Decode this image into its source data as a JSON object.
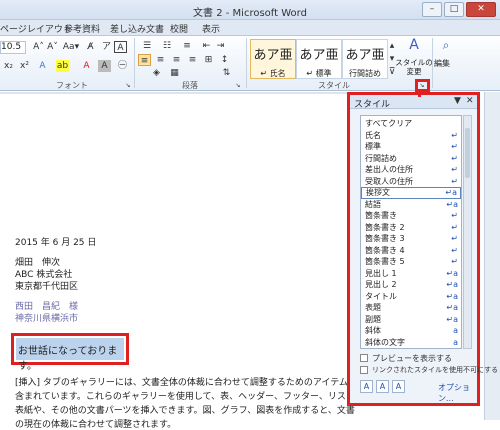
{
  "window": {
    "title": "文書 2 - Microsoft Word",
    "min": "–",
    "max": "□",
    "close": "✕"
  },
  "tabs": [
    "ページレイアウト",
    "参考資料",
    "差し込み文書",
    "校閲",
    "表示"
  ],
  "ribbon": {
    "font_size": "10.5",
    "font_labels": [
      "A˄",
      "A˅",
      "Aa▾",
      "A̸",
      "ア",
      "A"
    ],
    "font_group_label": "フォント",
    "para_group_label": "段落",
    "style_group_label": "スタイル",
    "style_boxes": [
      {
        "preview": "あア亜",
        "name": "↵ 氏名"
      },
      {
        "preview": "あア亜",
        "name": "↵ 標準"
      },
      {
        "preview": "あア亜",
        "name": "行間詰め"
      }
    ],
    "change_style": "スタイルの\n変更",
    "edit": "編集"
  },
  "document": {
    "date": "2015 年 6 月 25 日",
    "lines": [
      "畑田　伸次",
      "ABC 株式会社",
      "東京都千代田区"
    ],
    "recipient": "西田　昌紀　様",
    "address": "神奈川県横浜市",
    "highlighted": "お世話になっております。",
    "body": [
      "[挿入] タブのギャラリーには、文書全体の体裁に合わせて調整するためのアイテムが",
      "含まれています。これらのギャラリーを使用して、表、ヘッダー、フッター、リスト、",
      "表紙や、その他の文書パーツを挿入できます。図、グラフ、図表を作成すると、文書",
      "の現在の体裁に合わせて調整されます。"
    ]
  },
  "styles_pane": {
    "title": "スタイル",
    "items": [
      {
        "label": "すべてクリア",
        "mark": ""
      },
      {
        "label": "氏名",
        "mark": "↵"
      },
      {
        "label": "標準",
        "mark": "↵"
      },
      {
        "label": "行間詰め",
        "mark": "↵"
      },
      {
        "label": "差出人の住所",
        "mark": "↵"
      },
      {
        "label": "受取人の住所",
        "mark": "↵"
      },
      {
        "label": "挨拶文",
        "mark": "↵a"
      },
      {
        "label": "結語",
        "mark": "↵a"
      },
      {
        "label": "箇条書き",
        "mark": "↵"
      },
      {
        "label": "箇条書き 2",
        "mark": "↵"
      },
      {
        "label": "箇条書き 3",
        "mark": "↵"
      },
      {
        "label": "箇条書き 4",
        "mark": "↵"
      },
      {
        "label": "箇条書き 5",
        "mark": "↵"
      },
      {
        "label": "見出し 1",
        "mark": "↵a"
      },
      {
        "label": "見出し 2",
        "mark": "↵a"
      },
      {
        "label": "タイトル",
        "mark": "↵a"
      },
      {
        "label": "表題",
        "mark": "↵a"
      },
      {
        "label": "副題",
        "mark": "↵a"
      },
      {
        "label": "斜体",
        "mark": "a"
      },
      {
        "label": "斜体の文字",
        "mark": "a"
      }
    ],
    "selected_index": 6,
    "preview_label": "プレビューを表示する",
    "linked_label": "リンクされたスタイルを使用不可にする",
    "options": "オプション..."
  },
  "colors": {
    "accent_red": "#e02020",
    "selection_blue": "#bcd3ee"
  }
}
